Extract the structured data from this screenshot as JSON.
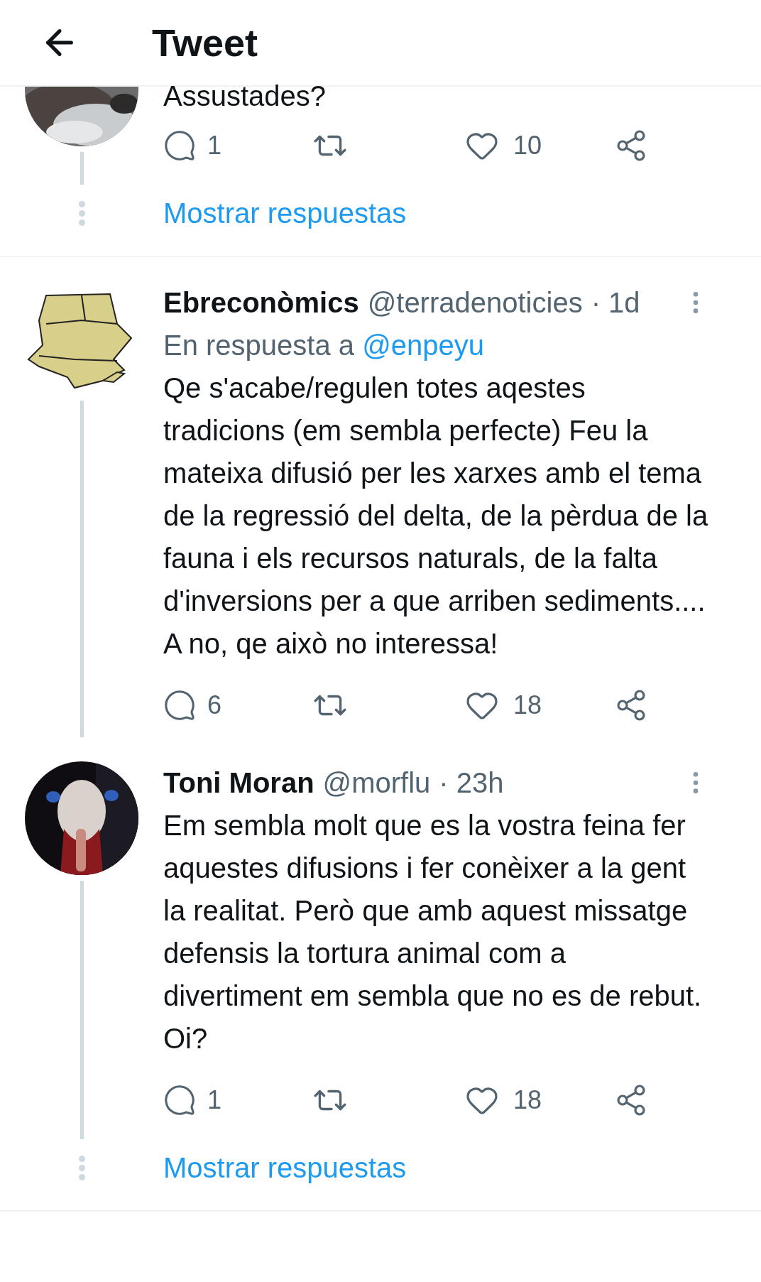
{
  "header": {
    "title": "Tweet"
  },
  "tweets": [
    {
      "kind": "cut",
      "text": "Assustades?",
      "replies": "1",
      "likes": "10",
      "thread_below": true,
      "show_replies": "Mostrar respuestas"
    },
    {
      "kind": "full",
      "name": "Ebreconòmics",
      "handle": "@terradenoticies",
      "time": "· 1d",
      "reply_prefix": "En respuesta a",
      "reply_to": "@enpeyu",
      "text": "Qe s'acabe/regulen totes aqestes tradicions (em sembla perfecte) Feu la mateixa difusió per les xarxes amb el tema de la regressió del delta, de la pèrdua de la fauna i els recursos naturals, de la falta d'inversions per a que arriben sediments.... A no, qe això no interessa!",
      "replies": "6",
      "likes": "18",
      "thread_below": true
    },
    {
      "kind": "full",
      "name": "Toni Moran",
      "handle": "@morflu",
      "time": "· 23h",
      "text": "Em sembla molt que es la vostra feina fer aquestes difusions i fer conèixer a la gent la realitat. Però que amb aquest missatge defensis la tortura animal com a divertiment em sembla que no es de rebut. Oi?",
      "replies": "1",
      "likes": "18",
      "thread_below": true,
      "show_replies": "Mostrar respuestas"
    }
  ]
}
